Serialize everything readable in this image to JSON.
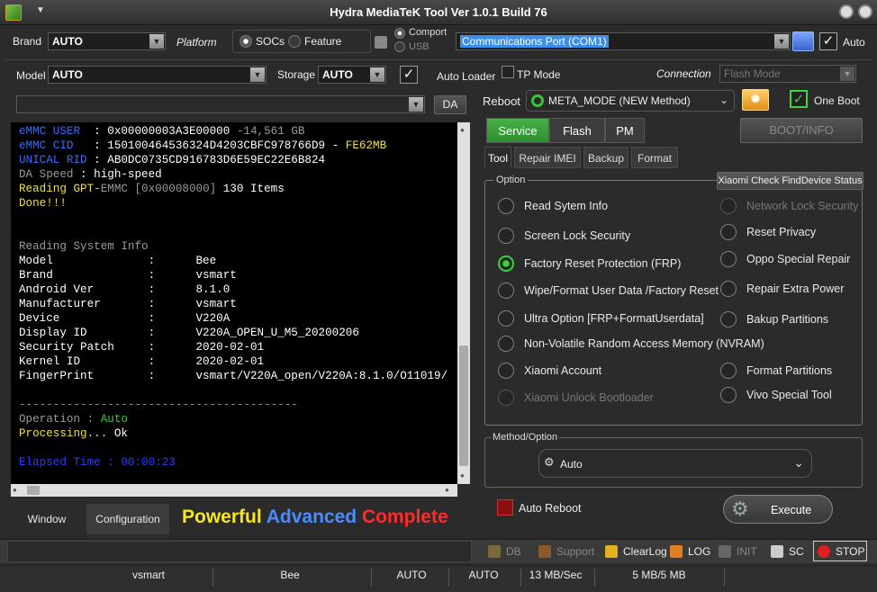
{
  "window": {
    "title": "Hydra MediaTeK Tool  Ver 1.0.1 Build 76"
  },
  "top": {
    "brand_label": "Brand",
    "brand_value": "AUTO",
    "platform_label": "Platform",
    "socs_label": "SOCs",
    "feature_label": "Feature",
    "comport_label": "Comport",
    "usb_label": "USB",
    "port_value": "Communications Port (COM1)",
    "auto_label": "Auto",
    "model_label": "Model",
    "model_value": "AUTO",
    "storage_label": "Storage",
    "storage_value": "AUTO",
    "auto_loader_label": "Auto Loader",
    "tp_mode_label": "TP Mode",
    "connection_label": "Connection",
    "connection_value": "Flash Mode",
    "da_button": "DA",
    "reboot_label": "Reboot",
    "reboot_value": "META_MODE (NEW Method)",
    "one_boot_label": "One Boot"
  },
  "console": {
    "lines": [
      [
        {
          "t": "eMMC USER  ",
          "c": "#3a6cff"
        },
        {
          "t": ": 0x00000003A3E00000 ",
          "c": "#ffffff"
        },
        {
          "t": "-14,561 GB",
          "c": "#9a9a9a"
        }
      ],
      [
        {
          "t": "eMMC CID   ",
          "c": "#3a6cff"
        },
        {
          "t": ": 150100464536324D4203CBFC978766D9 ",
          "c": "#ffffff"
        },
        {
          "t": "- ",
          "c": "#ffffff"
        },
        {
          "t": "FE62MB",
          "c": "#f0e040"
        }
      ],
      [
        {
          "t": "UNICAL RID ",
          "c": "#3a6cff"
        },
        {
          "t": ": AB0DC0735CD916783D6E59EC22E6B824",
          "c": "#ffffff"
        }
      ],
      [
        {
          "t": "DA Speed ",
          "c": "#9a9a9a"
        },
        {
          "t": ": high-speed",
          "c": "#ffffff"
        }
      ],
      [
        {
          "t": "Reading GPT-",
          "c": "#f0e040"
        },
        {
          "t": "EMMC [0x00008000] ",
          "c": "#9a9a9a"
        },
        {
          "t": "130 Items",
          "c": "#ffffff"
        }
      ],
      [
        {
          "t": "Done!!!",
          "c": "#f0e040"
        }
      ],
      [
        {
          "t": "",
          "c": "#ffffff"
        }
      ],
      [
        {
          "t": "",
          "c": "#ffffff"
        }
      ],
      [
        {
          "t": "Reading System Info",
          "c": "#9a9a9a"
        }
      ],
      [
        {
          "t": "Model              :      Bee",
          "c": "#ffffff"
        }
      ],
      [
        {
          "t": "Brand              :      vsmart",
          "c": "#ffffff"
        }
      ],
      [
        {
          "t": "Android Ver        :      8.1.0",
          "c": "#ffffff"
        }
      ],
      [
        {
          "t": "Manufacturer       :      vsmart",
          "c": "#ffffff"
        }
      ],
      [
        {
          "t": "Device             :      V220A",
          "c": "#ffffff"
        }
      ],
      [
        {
          "t": "Display ID         :      V220A_OPEN_U_M5_20200206",
          "c": "#ffffff"
        }
      ],
      [
        {
          "t": "Security Patch     :      2020-02-01",
          "c": "#ffffff"
        }
      ],
      [
        {
          "t": "Kernel ID          :      2020-02-01",
          "c": "#ffffff"
        }
      ],
      [
        {
          "t": "FingerPrint        :      vsmart/V220A_open/V220A:8.1.0/O11019/",
          "c": "#ffffff"
        }
      ],
      [
        {
          "t": "",
          "c": "#ffffff"
        }
      ],
      [
        {
          "t": "-----------------------------------------",
          "c": "#3cc83c"
        }
      ],
      [
        {
          "t": "Operation : ",
          "c": "#9a9a9a"
        },
        {
          "t": "Auto",
          "c": "#3cc83c"
        }
      ],
      [
        {
          "t": "Processing... ",
          "c": "#f0e040"
        },
        {
          "t": "Ok",
          "c": "#ffffff"
        }
      ],
      [
        {
          "t": "",
          "c": "#ffffff"
        }
      ],
      [
        {
          "t": "Elapsed Time : 00:00:23",
          "c": "#2a3cff"
        }
      ]
    ]
  },
  "bottom_left": {
    "window_tab": "Window",
    "config_tab": "Configuration",
    "slogan_1": "Powerful",
    "slogan_2": "Advanced",
    "slogan_3": "Complete"
  },
  "tabs": {
    "main": [
      "Service",
      "Flash",
      "PM"
    ],
    "boot_info": "BOOT/INFO",
    "sub": [
      "Tool",
      "Repair IMEI",
      "Backup",
      "Format"
    ],
    "xiaomi_check": "Xiaomi Check FindDevice Status"
  },
  "options": {
    "title": "Option",
    "left": [
      {
        "label": "Read Sytem Info",
        "selected": false,
        "enabled": true
      },
      {
        "label": "Screen Lock Security",
        "selected": false,
        "enabled": true
      },
      {
        "label": "Factory Reset Protection (FRP)",
        "selected": true,
        "enabled": true
      },
      {
        "label": "Wipe/Format User Data /Factory Reset",
        "selected": false,
        "enabled": true
      },
      {
        "label": "Ultra Option [FRP+FormatUserdata]",
        "selected": false,
        "enabled": true
      },
      {
        "label": "Non-Volatile Random Access Memory (NVRAM)",
        "selected": false,
        "enabled": true
      },
      {
        "label": "Xiaomi Account",
        "selected": false,
        "enabled": true
      },
      {
        "label": "Xiaomi Unlock Bootloader",
        "selected": false,
        "enabled": false
      }
    ],
    "right": [
      {
        "label": "Network Lock Security",
        "selected": false,
        "enabled": false
      },
      {
        "label": "Reset Privacy",
        "selected": false,
        "enabled": true
      },
      {
        "label": "Oppo Special Repair",
        "selected": false,
        "enabled": true
      },
      {
        "label": "Repair Extra Power",
        "selected": false,
        "enabled": true
      },
      {
        "label": "Bakup Partitions",
        "selected": false,
        "enabled": true
      },
      {
        "label": "Format Partitions",
        "selected": false,
        "enabled": true
      },
      {
        "label": "Vivo Special Tool",
        "selected": false,
        "enabled": true
      }
    ]
  },
  "method": {
    "title": "Method/Option",
    "value": "Auto"
  },
  "actions": {
    "auto_reboot_label": "Auto Reboot",
    "execute_label": "Execute"
  },
  "toolbar": {
    "db": "DB",
    "support": "Support",
    "clearlog": "ClearLog",
    "log": "LOG",
    "init": "INIT",
    "sc": "SC",
    "stop": "STOP"
  },
  "status": {
    "brand": "vsmart",
    "model": "Bee",
    "storage": "AUTO",
    "platform": "AUTO",
    "speed": "13 MB/Sec",
    "progress": "5 MB/5 MB"
  },
  "colors": {
    "accent_green": "#2d9a2f",
    "slogan_yellow": "#f5e620",
    "slogan_blue": "#4b8cff",
    "slogan_red": "#ff2a2a"
  }
}
